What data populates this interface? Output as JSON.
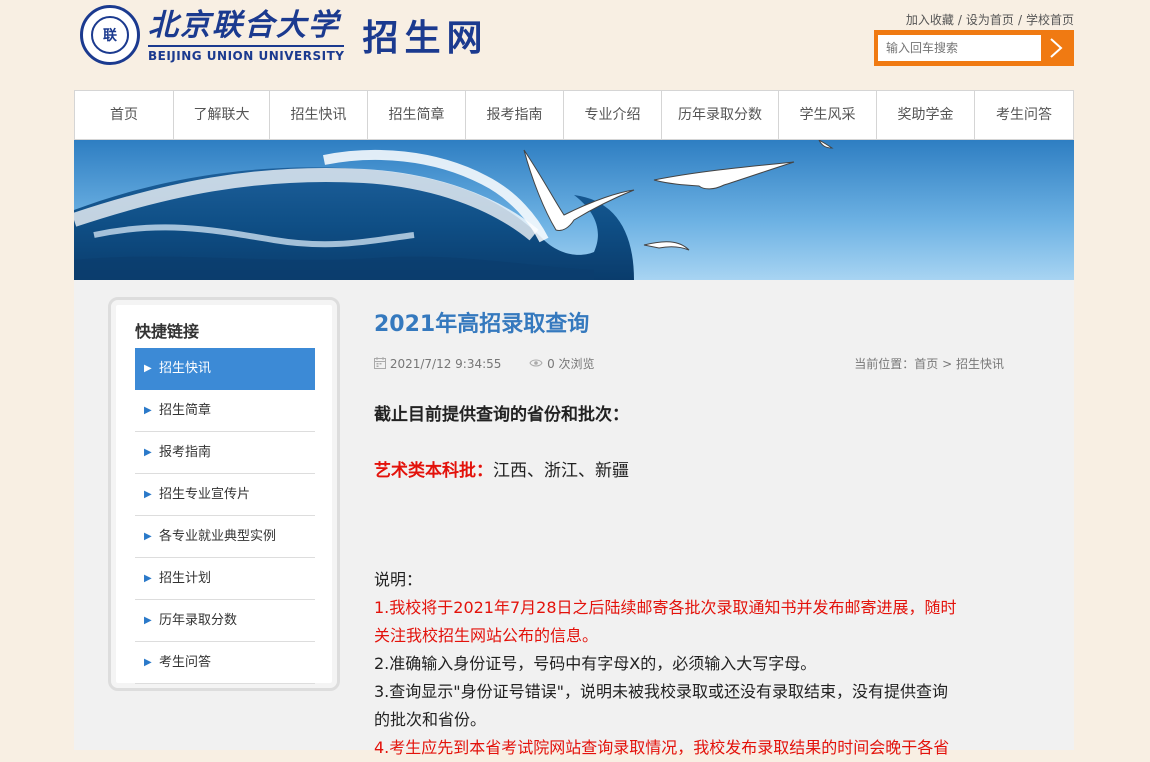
{
  "header": {
    "school_seal_text": "联",
    "school_name_cn": "北京联合大学",
    "school_name_en": "BEIJING UNION UNIVERSITY",
    "site_name": "招生网",
    "toplinks": [
      "加入收藏",
      "设为首页",
      "学校首页"
    ],
    "toplinks_sep": "/",
    "search_placeholder": "输入回车搜索"
  },
  "nav": {
    "items": [
      {
        "label": "首页"
      },
      {
        "label": "了解联大"
      },
      {
        "label": "招生快讯"
      },
      {
        "label": "招生简章"
      },
      {
        "label": "报考指南"
      },
      {
        "label": "专业介绍"
      },
      {
        "label": "历年录取分数"
      },
      {
        "label": "学生风采"
      },
      {
        "label": "奖助学金"
      },
      {
        "label": "考生问答"
      }
    ]
  },
  "sidebar": {
    "title": "快捷链接",
    "items": [
      {
        "label": "招生快讯",
        "active": true
      },
      {
        "label": "招生简章",
        "active": false
      },
      {
        "label": "报考指南",
        "active": false
      },
      {
        "label": "招生专业宣传片",
        "active": false
      },
      {
        "label": "各专业就业典型实例",
        "active": false
      },
      {
        "label": "招生计划",
        "active": false
      },
      {
        "label": "历年录取分数",
        "active": false
      },
      {
        "label": "考生问答",
        "active": false
      }
    ]
  },
  "article": {
    "title": "2021年高招录取查询",
    "datetime": "2021/7/12 9:34:55",
    "views": "0 次浏览",
    "breadcrumb_prefix": "当前位置：",
    "breadcrumb_home": "首页",
    "breadcrumb_sep": ">",
    "breadcrumb_current": "招生快讯",
    "heading": "截止目前提供查询的省份和批次：",
    "art_label": "艺术类本科批：",
    "art_provinces": "江西、浙江、新疆",
    "note_title": "说明：",
    "note_1_line1": "1.我校将于2021年7月28日之后陆续邮寄各批次录取通知书并发布邮寄进展，随时",
    "note_1_line2": "关注我校招生网站公布的信息。",
    "note_2": "2.准确输入身份证号，号码中有字母X的，必须输入大写字母。",
    "note_3_line1": "3.查询显示\"身份证号错误\"，说明未被我校录取或还没有录取结束，没有提供查询",
    "note_3_line2": "的批次和省份。",
    "note_4_line1": "4.考生应先到本省考试院网站查询录取情况，我校发布录取结果的时间会晚于各省"
  },
  "colors": {
    "brand_blue": "#1b3a8f",
    "search_orange": "#f07a12",
    "title_blue": "#3579be",
    "sidebar_active": "#3c8ad6",
    "highlight_red": "#e3120b"
  }
}
